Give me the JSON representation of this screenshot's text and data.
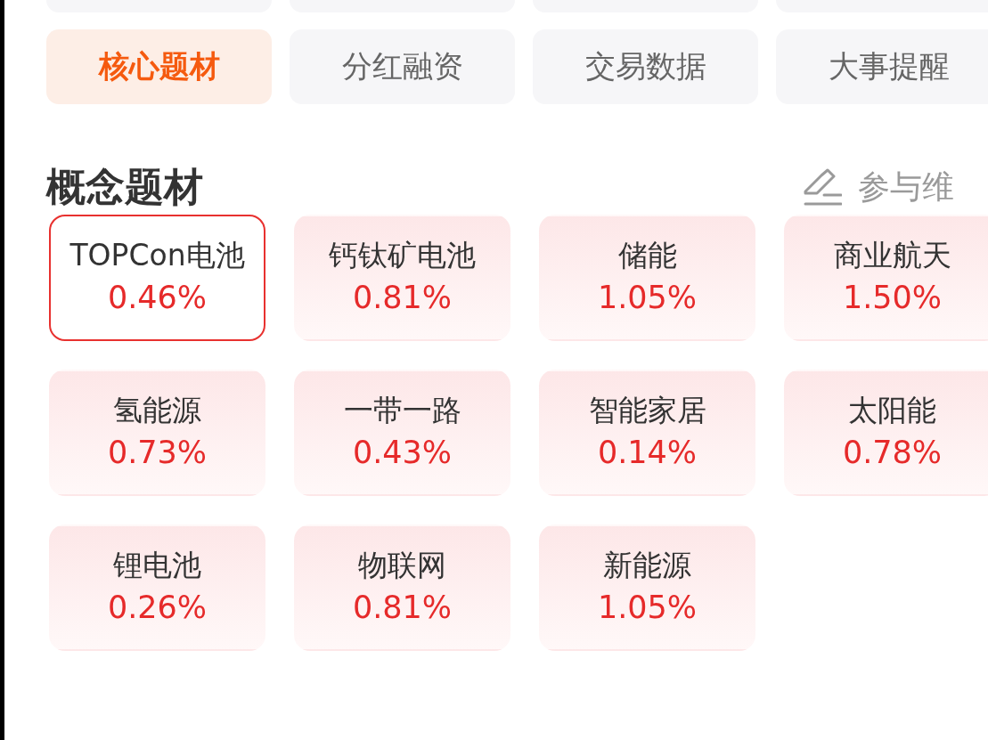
{
  "tabs": [
    {
      "label": "核心题材",
      "selected": true
    },
    {
      "label": "分红融资",
      "selected": false
    },
    {
      "label": "交易数据",
      "selected": false
    },
    {
      "label": "大事提醒",
      "selected": false
    }
  ],
  "section": {
    "title": "概念题材",
    "action": "参与维"
  },
  "concepts": [
    {
      "name": "TOPCon电池",
      "change": "0.46%",
      "selected": true
    },
    {
      "name": "钙钛矿电池",
      "change": "0.81%",
      "selected": false
    },
    {
      "name": "储能",
      "change": "1.05%",
      "selected": false
    },
    {
      "name": "商业航天",
      "change": "1.50%",
      "selected": false
    },
    {
      "name": "氢能源",
      "change": "0.73%",
      "selected": false
    },
    {
      "name": "一带一路",
      "change": "0.43%",
      "selected": false
    },
    {
      "name": "智能家居",
      "change": "0.14%",
      "selected": false
    },
    {
      "name": "太阳能",
      "change": "0.78%",
      "selected": false
    },
    {
      "name": "锂电池",
      "change": "0.26%",
      "selected": false
    },
    {
      "name": "物联网",
      "change": "0.81%",
      "selected": false
    },
    {
      "name": "新能源",
      "change": "1.05%",
      "selected": false
    }
  ]
}
